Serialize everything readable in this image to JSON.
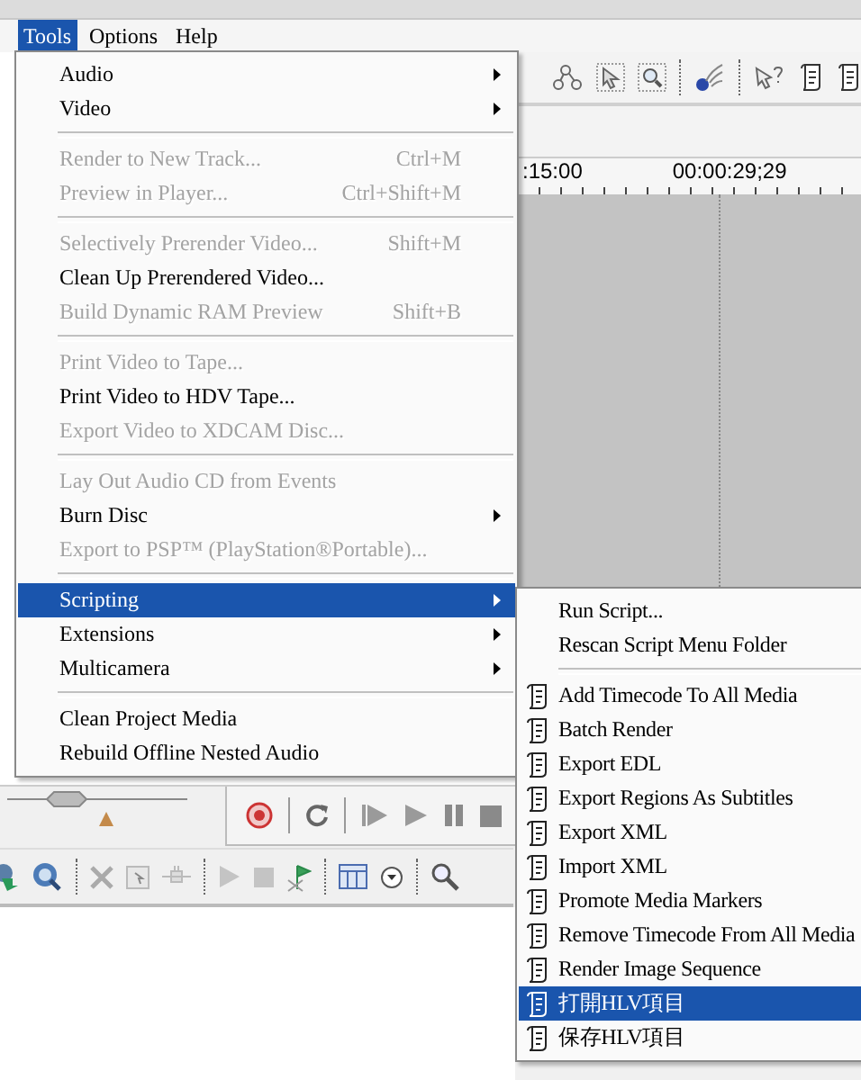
{
  "menu_bar": [
    {
      "label": "Tools",
      "selected": true
    },
    {
      "label": "Options",
      "selected": false
    },
    {
      "label": "Help",
      "selected": false
    }
  ],
  "tools_menu": {
    "groups": [
      [
        {
          "label": "Audio",
          "submenu": true,
          "disabled": false,
          "selected": false
        },
        {
          "label": "Video",
          "submenu": true,
          "disabled": false,
          "selected": false
        }
      ],
      [
        {
          "label": "Render to New Track...",
          "shortcut": "Ctrl+M",
          "submenu": false,
          "disabled": true,
          "selected": false
        },
        {
          "label": "Preview in Player...",
          "shortcut": "Ctrl+Shift+M",
          "submenu": false,
          "disabled": true,
          "selected": false
        }
      ],
      [
        {
          "label": "Selectively Prerender Video...",
          "shortcut": "Shift+M",
          "submenu": false,
          "disabled": true,
          "selected": false
        },
        {
          "label": "Clean Up Prerendered Video...",
          "submenu": false,
          "disabled": false,
          "selected": false
        },
        {
          "label": "Build Dynamic RAM Preview",
          "shortcut": "Shift+B",
          "submenu": false,
          "disabled": true,
          "selected": false
        }
      ],
      [
        {
          "label": "Print Video to Tape...",
          "submenu": false,
          "disabled": true,
          "selected": false
        },
        {
          "label": "Print Video to HDV Tape...",
          "submenu": false,
          "disabled": false,
          "selected": false
        },
        {
          "label": "Export Video to XDCAM Disc...",
          "submenu": false,
          "disabled": true,
          "selected": false
        }
      ],
      [
        {
          "label": "Lay Out Audio CD from Events",
          "submenu": false,
          "disabled": true,
          "selected": false
        },
        {
          "label": "Burn Disc",
          "submenu": true,
          "disabled": false,
          "selected": false
        },
        {
          "label": "Export to PSP™ (PlayStation®Portable)...",
          "submenu": false,
          "disabled": true,
          "selected": false
        }
      ],
      [
        {
          "label": "Scripting",
          "submenu": true,
          "disabled": false,
          "selected": true
        },
        {
          "label": "Extensions",
          "submenu": true,
          "disabled": false,
          "selected": false
        },
        {
          "label": "Multicamera",
          "submenu": true,
          "disabled": false,
          "selected": false
        }
      ],
      [
        {
          "label": "Clean Project Media",
          "submenu": false,
          "disabled": false,
          "selected": false
        },
        {
          "label": "Rebuild Offline Nested Audio",
          "submenu": false,
          "disabled": false,
          "selected": false
        }
      ]
    ]
  },
  "scripting_menu": {
    "groups": [
      [
        {
          "label": "Run Script...",
          "kind": "command",
          "selected": false
        },
        {
          "label": "Rescan Script Menu Folder",
          "kind": "command",
          "selected": false
        }
      ],
      [
        {
          "label": "Add Timecode To All Media",
          "kind": "script",
          "selected": false
        },
        {
          "label": "Batch Render",
          "kind": "script",
          "selected": false
        },
        {
          "label": "Export EDL",
          "kind": "script",
          "selected": false
        },
        {
          "label": "Export Regions As Subtitles",
          "kind": "script",
          "selected": false
        },
        {
          "label": "Export XML",
          "kind": "script",
          "selected": false
        },
        {
          "label": "Import XML",
          "kind": "script",
          "selected": false
        },
        {
          "label": "Promote Media Markers",
          "kind": "script",
          "selected": false
        },
        {
          "label": "Remove Timecode From All Media",
          "kind": "script",
          "selected": false
        },
        {
          "label": "Render Image Sequence",
          "kind": "script",
          "selected": false
        },
        {
          "label": "打開HLV項目",
          "kind": "script",
          "selected": true
        },
        {
          "label": "保存HLV項目",
          "kind": "script",
          "selected": false
        }
      ]
    ]
  },
  "timeline": {
    "ruler_labels": [
      ":15:00",
      "00:00:29;29"
    ]
  },
  "zoom_slider": {
    "level": 0.33
  }
}
